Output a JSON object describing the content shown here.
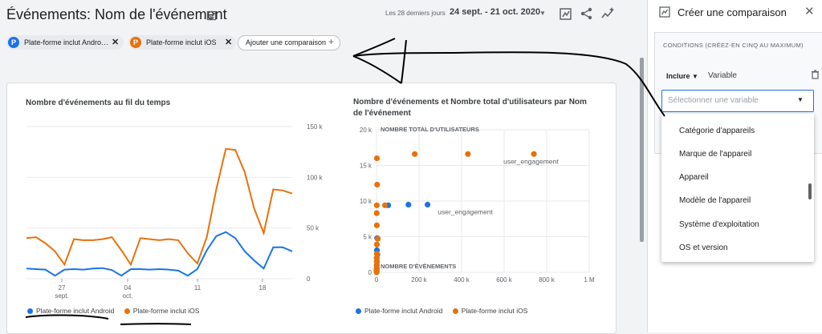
{
  "header": {
    "title": "Événements: Nom de l'événement",
    "date_range_label": "Les 28 derniers jours",
    "date_range": "24 sept. - 21 oct. 2020",
    "title_icon": "edit-report-icon",
    "action_icons": [
      "customize-report-icon",
      "share-icon",
      "insights-icon"
    ]
  },
  "comparisons": {
    "chips": [
      {
        "badge": "P",
        "label": "Plate-forme inclut Andro…",
        "color": "#1a73e8"
      },
      {
        "badge": "P",
        "label": "Plate-forme inclut iOS",
        "color": "#e8710a"
      }
    ],
    "add_label": "Ajouter une comparaison"
  },
  "chart_data": [
    {
      "type": "line",
      "title": "Nombre d'événements au fil du temps",
      "x_tick_labels": [
        "27",
        "sept.",
        "04",
        "oct.",
        "11",
        "18"
      ],
      "y_tick_labels": [
        "150 k",
        "100 k",
        "50 k",
        "0"
      ],
      "ylim": [
        0,
        150000
      ],
      "series": [
        {
          "name": "Plate-forme inclut Android",
          "color": "#1a73e8",
          "values": [
            10000,
            9500,
            9000,
            3000,
            9000,
            9500,
            9000,
            10000,
            10500,
            8500,
            3000,
            9500,
            9500,
            9000,
            9500,
            9000,
            8000,
            3000,
            9500,
            28000,
            42000,
            46000,
            40000,
            27000,
            18000,
            10000,
            31000,
            31000,
            27000
          ]
        },
        {
          "name": "Plate-forme inclut iOS",
          "color": "#e8710a",
          "values": [
            40000,
            41000,
            35000,
            27000,
            14000,
            39000,
            38000,
            38000,
            39000,
            41000,
            28000,
            14000,
            40000,
            39000,
            38000,
            39000,
            38000,
            25000,
            15000,
            41000,
            88000,
            128000,
            127000,
            105000,
            69000,
            45000,
            88000,
            87000,
            84000
          ]
        }
      ]
    },
    {
      "type": "scatter",
      "title": "Nombre d'événements et Nombre total d'utilisateurs par Nom de l'événement",
      "xlabel": "NOMBRE D'ÉVÉNEMENTS",
      "ylabel": "NOMBRE TOTAL D'UTILISATEURS",
      "x_tick_labels": [
        "0",
        "200 k",
        "400 k",
        "600 k",
        "800 k",
        "1 M"
      ],
      "y_tick_labels": [
        "20 k",
        "15 k",
        "10 k",
        "5 k",
        "0"
      ],
      "xlim": [
        0,
        1000000
      ],
      "ylim": [
        0,
        20000
      ],
      "annotations": [
        {
          "text": "user_engagement",
          "x": 740000,
          "y": 16600,
          "series": "Plate-forme inclut iOS"
        },
        {
          "text": "user_engagement",
          "x": 250000,
          "y": 9500,
          "series": "Plate-forme inclut Android"
        }
      ],
      "series": [
        {
          "name": "Plate-forme inclut Android",
          "color": "#1a73e8",
          "points": [
            [
              150000,
              9500
            ],
            [
              240000,
              9500
            ],
            [
              55000,
              9400
            ],
            [
              3000,
              4800
            ],
            [
              2000,
              3100
            ],
            [
              4000,
              2500
            ],
            [
              1000,
              2000
            ],
            [
              2000,
              1500
            ],
            [
              1500,
              1000
            ],
            [
              1000,
              600
            ],
            [
              500,
              300
            ],
            [
              300,
              100
            ]
          ]
        },
        {
          "name": "Plate-forme inclut iOS",
          "color": "#e8710a",
          "points": [
            [
              740000,
              16600
            ],
            [
              430000,
              16600
            ],
            [
              180000,
              16600
            ],
            [
              2000,
              16000
            ],
            [
              3000,
              12300
            ],
            [
              40000,
              9400
            ],
            [
              1500,
              9400
            ],
            [
              1000,
              8300
            ],
            [
              1500,
              6600
            ],
            [
              6000,
              4700
            ],
            [
              2000,
              3900
            ],
            [
              2000,
              2600
            ],
            [
              1500,
              2000
            ],
            [
              1000,
              1500
            ],
            [
              1200,
              1000
            ],
            [
              1500,
              500
            ],
            [
              1000,
              200
            ],
            [
              800,
              0
            ]
          ]
        }
      ]
    }
  ],
  "legend": {
    "android": "Plate-forme inclut Android",
    "ios": "Plate-forme inclut iOS"
  },
  "panel": {
    "title": "Créer une comparaison",
    "title_icon": "comparison-icon",
    "conditions_title": "CONDITIONS (CRÉEZ-EN CINQ AU MAXIMUM)",
    "include_label": "Inclure",
    "variable_label": "Variable",
    "select_placeholder": "Sélectionner une variable",
    "dropdown_items": [
      "Catégorie d'appareils",
      "Marque de l'appareil",
      "Appareil",
      "Modèle de l'appareil",
      "Système d'exploitation",
      "OS et version"
    ]
  }
}
